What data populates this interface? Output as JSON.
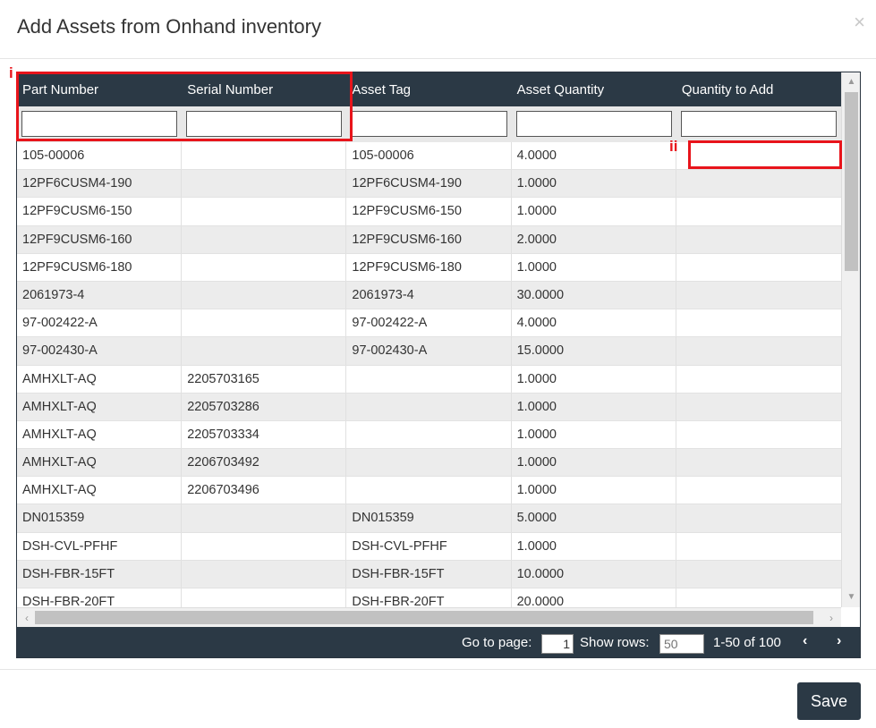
{
  "modal": {
    "title": "Add Assets from Onhand inventory",
    "close_label": "×"
  },
  "columns": [
    "Part Number",
    "Serial Number",
    "Asset Tag",
    "Asset Quantity",
    "Quantity to Add"
  ],
  "rows": [
    [
      "105-00006",
      "",
      "105-00006",
      "4.0000",
      ""
    ],
    [
      "12PF6CUSM4-190",
      "",
      "12PF6CUSM4-190",
      "1.0000",
      ""
    ],
    [
      "12PF9CUSM6-150",
      "",
      "12PF9CUSM6-150",
      "1.0000",
      ""
    ],
    [
      "12PF9CUSM6-160",
      "",
      "12PF9CUSM6-160",
      "2.0000",
      ""
    ],
    [
      "12PF9CUSM6-180",
      "",
      "12PF9CUSM6-180",
      "1.0000",
      ""
    ],
    [
      "2061973-4",
      "",
      "2061973-4",
      "30.0000",
      ""
    ],
    [
      "97-002422-A",
      "",
      "97-002422-A",
      "4.0000",
      ""
    ],
    [
      "97-002430-A",
      "",
      "97-002430-A",
      "15.0000",
      ""
    ],
    [
      "AMHXLT-AQ",
      "2205703165",
      "",
      "1.0000",
      ""
    ],
    [
      "AMHXLT-AQ",
      "2205703286",
      "",
      "1.0000",
      ""
    ],
    [
      "AMHXLT-AQ",
      "2205703334",
      "",
      "1.0000",
      ""
    ],
    [
      "AMHXLT-AQ",
      "2206703492",
      "",
      "1.0000",
      ""
    ],
    [
      "AMHXLT-AQ",
      "2206703496",
      "",
      "1.0000",
      ""
    ],
    [
      "DN015359",
      "",
      "DN015359",
      "5.0000",
      ""
    ],
    [
      "DSH-CVL-PFHF",
      "",
      "DSH-CVL-PFHF",
      "1.0000",
      ""
    ],
    [
      "DSH-FBR-15FT",
      "",
      "DSH-FBR-15FT",
      "10.0000",
      ""
    ],
    [
      "DSH-FBR-20FT",
      "",
      "DSH-FBR-20FT",
      "20.0000",
      ""
    ]
  ],
  "pager": {
    "goto_label": "Go to page:",
    "goto_value": "1",
    "rows_label": "Show rows:",
    "rows_placeholder": "50",
    "range": "1-50 of 100",
    "prev": "‹",
    "next": "›"
  },
  "save_label": "Save",
  "annotations": {
    "label_i": "i",
    "label_ii": "ii",
    "color": "#e8141b"
  },
  "colors": {
    "header_bg": "#2b3945",
    "row_alt": "#ececec"
  }
}
